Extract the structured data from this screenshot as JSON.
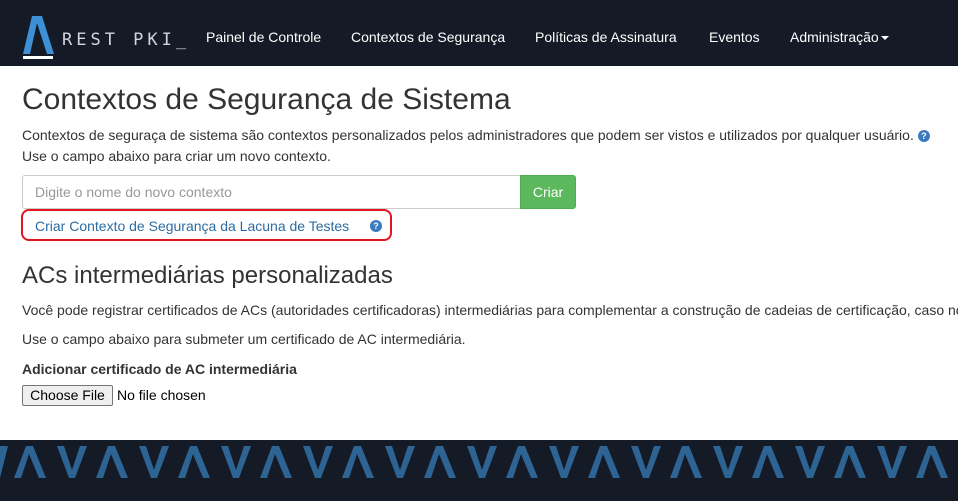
{
  "header": {
    "brand": "REST PKI_",
    "nav": [
      {
        "label": "Painel de Controle"
      },
      {
        "label": "Contextos de Segurança"
      },
      {
        "label": "Políticas de Assinatura"
      },
      {
        "label": "Eventos"
      },
      {
        "label": "Administração"
      }
    ]
  },
  "main": {
    "title": "Contextos de Segurança de Sistema",
    "description_line1": "Contextos de seguraça de sistema são contextos personalizados pelos administradores que podem ser vistos e utilizados por qualquer usuário.",
    "description_line2": "Use o campo abaixo para criar um novo contexto.",
    "new_context_input": {
      "value": "",
      "placeholder": "Digite o nome do novo contexto"
    },
    "create_button": "Criar",
    "test_context_link": "Criar Contexto de Segurança da Lacuna de Testes"
  },
  "intermediate": {
    "title": "ACs intermediárias personalizadas",
    "paragraph1": "Você pode registrar certificados de ACs (autoridades certificadoras) intermediárias para complementar a construção de cadeias de certificação, caso no",
    "paragraph2": "Use o campo abaixo para submeter um certificado de AC intermediária.",
    "field_label": "Adicionar certificado de AC intermediária",
    "file_button": "Choose File",
    "file_status": "No file chosen"
  },
  "icons": {
    "help": "question-circle-icon",
    "brand_logo": "lambda-logo-icon",
    "dropdown": "caret-down-icon"
  },
  "colors": {
    "navbar": "#141a26",
    "footer_pattern": "#2e6494",
    "link": "#2d6ca2",
    "success": "#5cb85c",
    "highlight": "#e2141e"
  }
}
